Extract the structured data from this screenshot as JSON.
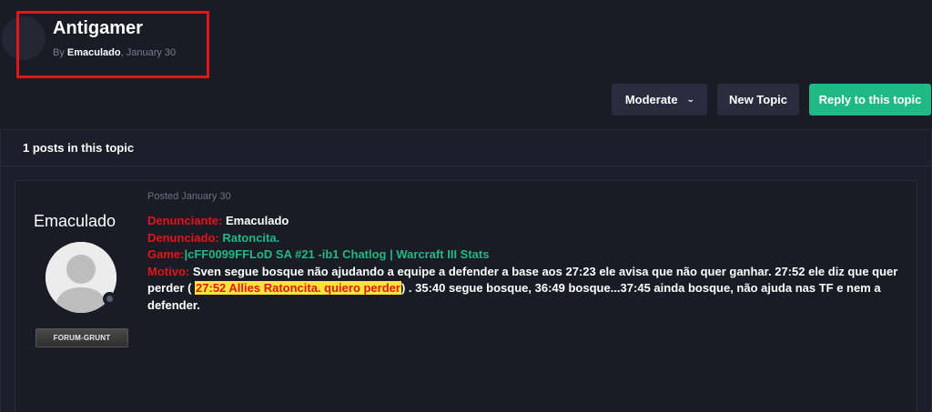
{
  "topic": {
    "title": "Antigamer",
    "by_prefix": "By",
    "author": "Emaculado",
    "date_sep": ",",
    "date": "January 30"
  },
  "actions": {
    "moderate_label": "Moderate",
    "moderate_chevron": "⌄",
    "new_topic_label": "New Topic",
    "reply_label": "Reply to this topic"
  },
  "posts": {
    "count_label": "1 posts in this topic"
  },
  "post": {
    "author_name": "Emaculado",
    "rank": "FORUM-GRUNT",
    "posted": "Posted January 30",
    "denunciante_label": "Denunciante:",
    "denunciante_value": "Emaculado",
    "denunciado_label": "Denunciado:",
    "denunciado_value": "Ratoncita.",
    "game_label": "Game:",
    "game_value": "|cFF0099FFLoD SA #21 -ib1 Chatlog | Warcraft III Stats",
    "motivo_label": "Motivo:",
    "motivo_text_1": "Sven segue bosque não ajudando a equipe a defender a base aos 27:23  ele avisa que não quer ganhar. 27:52 ele diz que quer perder (",
    "motivo_highlight": "27:52 Allies Ratoncita. quiero perder",
    "motivo_text_2": ") . 35:40 segue bosque, 36:49 bosque...37:45 ainda bosque, não ajuda nas TF e nem a defender."
  },
  "colors": {
    "background": "#1b1b26",
    "accent_green": "#1fb985",
    "label_red": "#e3141a",
    "highlight_yellow": "#ffe536",
    "annotation_box": "#e3141a"
  }
}
